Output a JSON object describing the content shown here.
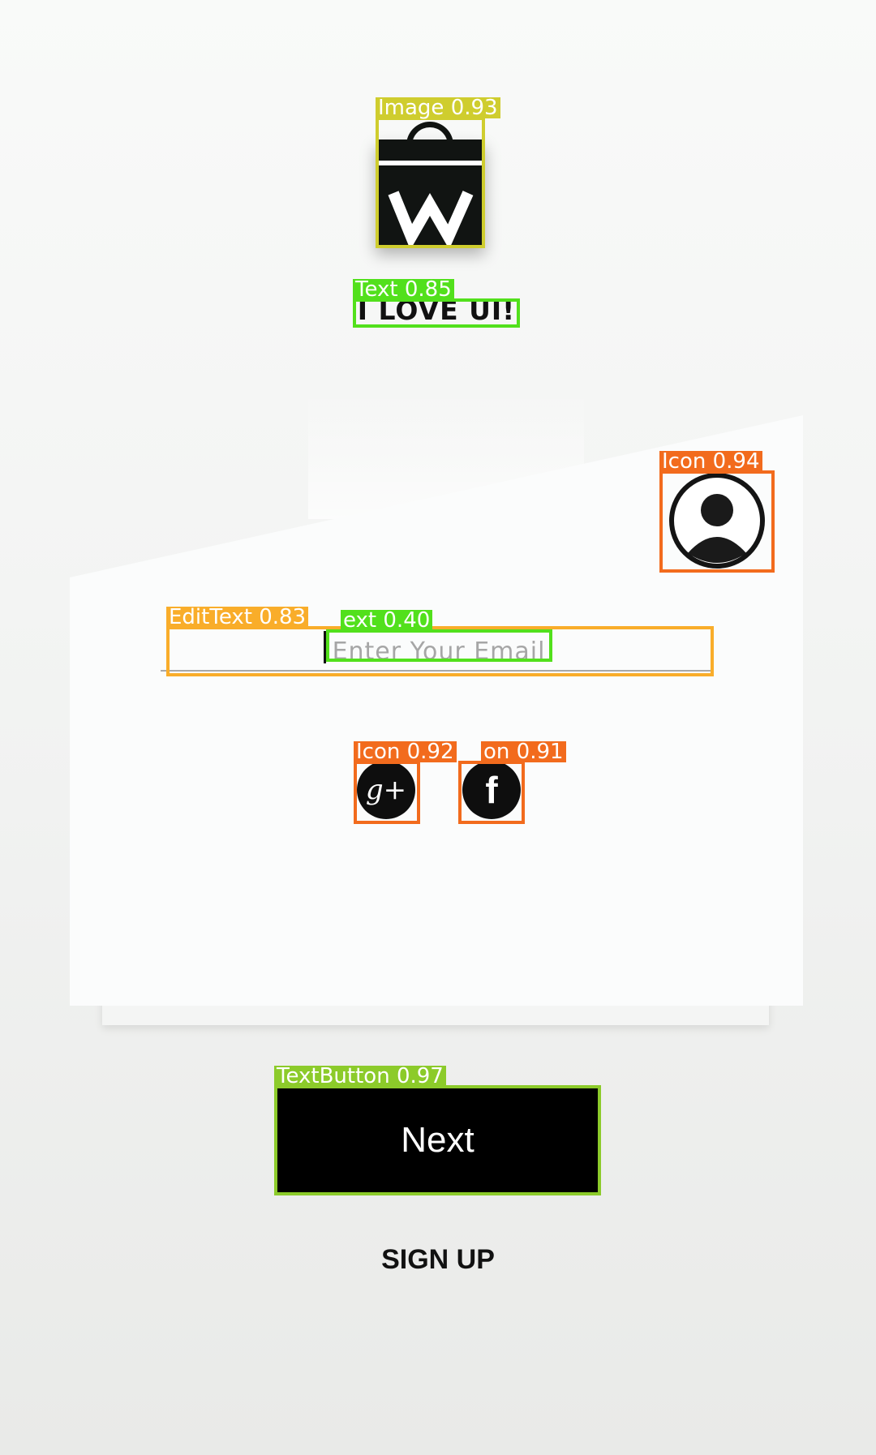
{
  "brand": {
    "logo_icon": "shopping-bag-w-logo",
    "logo_letter": "W",
    "tagline": "I LOVE UI!"
  },
  "form": {
    "email_placeholder": "Enter Your Email",
    "email_value": "",
    "avatar_icon": "user-circle-icon",
    "social": [
      {
        "icon": "google-plus-icon",
        "glyph": "g+"
      },
      {
        "icon": "facebook-icon",
        "glyph": "f"
      }
    ]
  },
  "actions": {
    "next_label": "Next",
    "signup_label": "SIGN UP"
  },
  "detections": [
    {
      "label": "Image",
      "score": "0.93",
      "display": "Image  0.93",
      "color": "#cfcd2e"
    },
    {
      "label": "Text",
      "score": "0.85",
      "display": "Text  0.85",
      "color": "#52e01c"
    },
    {
      "label": "Icon",
      "score": "0.94",
      "display": "Icon  0.94",
      "color": "#f26b1d"
    },
    {
      "label": "EditText",
      "score": "0.83",
      "display": "EditText  0.83",
      "color": "#f9ad2a"
    },
    {
      "label": "Text",
      "score": "0.40",
      "display": "ext  0.40",
      "color": "#52e01c"
    },
    {
      "label": "Icon",
      "score": "0.92",
      "display": "Icon  0.92",
      "color": "#f26b1d"
    },
    {
      "label": "Icon",
      "score": "0.91",
      "display": "on  0.91",
      "color": "#f26b1d"
    },
    {
      "label": "TextButton",
      "score": "0.97",
      "display": "TextButton  0.97",
      "color": "#8ccb2a"
    }
  ],
  "colors": {
    "background": "#f4f5f4",
    "card": "#fbfcfc",
    "button": "#000000",
    "text": "#111111"
  }
}
